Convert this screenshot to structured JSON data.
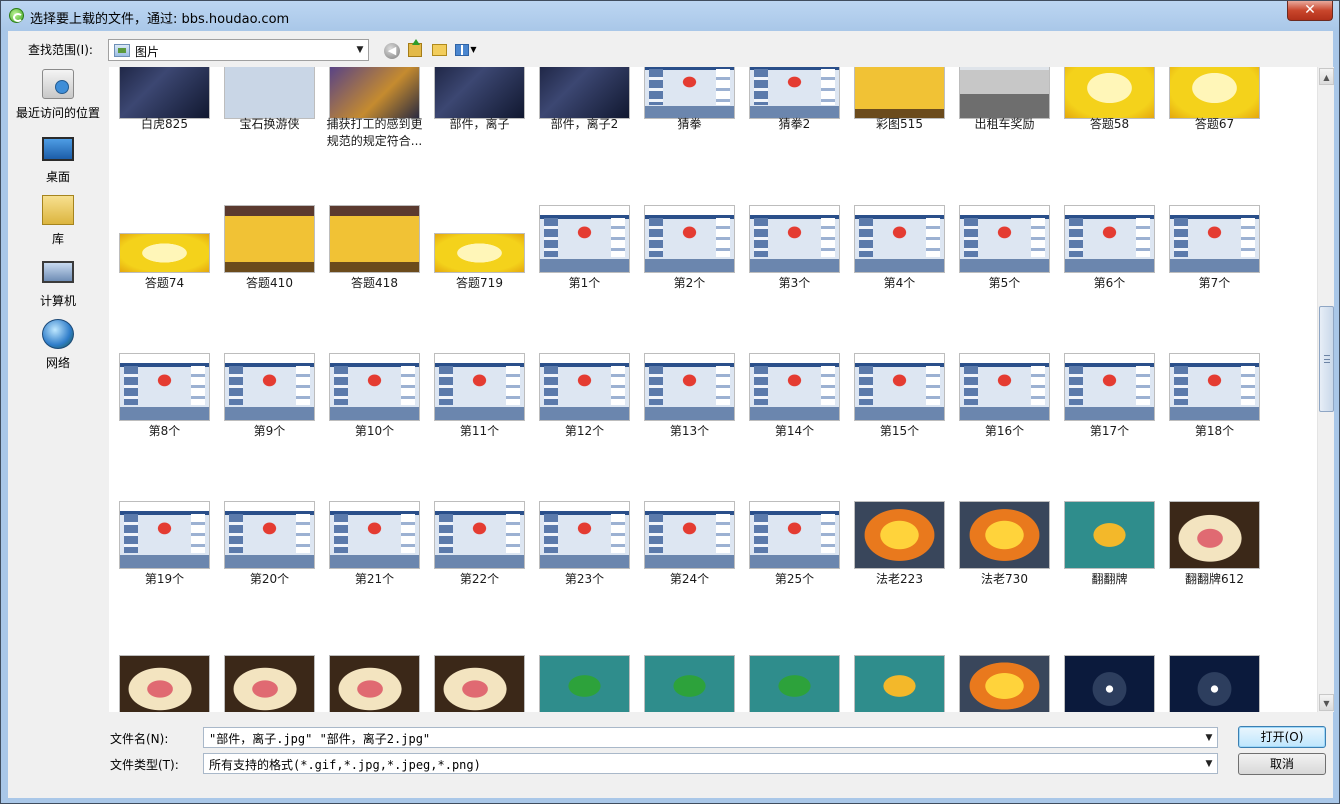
{
  "window": {
    "title": "选择要上载的文件，通过: bbs.houdao.com",
    "close_label": "✕"
  },
  "toolbar": {
    "lookin_label": "查找范围(I):",
    "lookin_value": "图片",
    "icons": [
      "back-icon",
      "up-folder-icon",
      "new-folder-icon",
      "view-menu-icon"
    ]
  },
  "places": [
    {
      "label": "最近访问的位置",
      "icon": "recent-places-icon"
    },
    {
      "label": "桌面",
      "icon": "desktop-icon"
    },
    {
      "label": "库",
      "icon": "libraries-icon"
    },
    {
      "label": "计算机",
      "icon": "computer-icon"
    },
    {
      "label": "网络",
      "icon": "network-icon"
    }
  ],
  "files": [
    {
      "name": "白虎825",
      "thumb": "t-dark"
    },
    {
      "name": "宝石换游侠",
      "thumb": "t-dialog"
    },
    {
      "name": "捕获打工的感到更规范的规定符合...",
      "thumb": "t-purple"
    },
    {
      "name": "部件，离子",
      "thumb": "t-dark"
    },
    {
      "name": "部件，离子2",
      "thumb": "t-dark"
    },
    {
      "name": "猜拳",
      "thumb": "t-game"
    },
    {
      "name": "猜拳2",
      "thumb": "t-game"
    },
    {
      "name": "彩图515",
      "thumb": "t-cbg"
    },
    {
      "name": "出租车奖励",
      "thumb": "t-city"
    },
    {
      "name": "答题58",
      "thumb": "t-yellow"
    },
    {
      "name": "答题67",
      "thumb": "t-yellow"
    },
    {
      "name": "答题74",
      "thumb": "t-yellow"
    },
    {
      "name": "答题410",
      "thumb": "t-cbg"
    },
    {
      "name": "答题418",
      "thumb": "t-cbg"
    },
    {
      "name": "答题719",
      "thumb": "t-yellow"
    },
    {
      "name": "第1个",
      "thumb": "t-game"
    },
    {
      "name": "第2个",
      "thumb": "t-game"
    },
    {
      "name": "第3个",
      "thumb": "t-game"
    },
    {
      "name": "第4个",
      "thumb": "t-game"
    },
    {
      "name": "第5个",
      "thumb": "t-game"
    },
    {
      "name": "第6个",
      "thumb": "t-game"
    },
    {
      "name": "第7个",
      "thumb": "t-game"
    },
    {
      "name": "第8个",
      "thumb": "t-game"
    },
    {
      "name": "第9个",
      "thumb": "t-game"
    },
    {
      "name": "第10个",
      "thumb": "t-game"
    },
    {
      "name": "第11个",
      "thumb": "t-game"
    },
    {
      "name": "第12个",
      "thumb": "t-game"
    },
    {
      "name": "第13个",
      "thumb": "t-game"
    },
    {
      "name": "第14个",
      "thumb": "t-game"
    },
    {
      "name": "第15个",
      "thumb": "t-game"
    },
    {
      "name": "第16个",
      "thumb": "t-game"
    },
    {
      "name": "第17个",
      "thumb": "t-game"
    },
    {
      "name": "第18个",
      "thumb": "t-game"
    },
    {
      "name": "第19个",
      "thumb": "t-game"
    },
    {
      "name": "第20个",
      "thumb": "t-game"
    },
    {
      "name": "第21个",
      "thumb": "t-game"
    },
    {
      "name": "第22个",
      "thumb": "t-game"
    },
    {
      "name": "第23个",
      "thumb": "t-game"
    },
    {
      "name": "第24个",
      "thumb": "t-game"
    },
    {
      "name": "第25个",
      "thumb": "t-game"
    },
    {
      "name": "法老223",
      "thumb": "t-fire"
    },
    {
      "name": "法老730",
      "thumb": "t-fire"
    },
    {
      "name": "翻翻牌",
      "thumb": "t-teal-y"
    },
    {
      "name": "翻翻牌612",
      "thumb": "t-monster"
    },
    {
      "name": "",
      "thumb": "t-monster"
    },
    {
      "name": "",
      "thumb": "t-monster"
    },
    {
      "name": "",
      "thumb": "t-monster"
    },
    {
      "name": "",
      "thumb": "t-monster"
    },
    {
      "name": "",
      "thumb": "t-teal"
    },
    {
      "name": "",
      "thumb": "t-teal"
    },
    {
      "name": "",
      "thumb": "t-teal"
    },
    {
      "name": "",
      "thumb": "t-teal-y"
    },
    {
      "name": "",
      "thumb": "t-fire"
    },
    {
      "name": "",
      "thumb": "t-spin"
    },
    {
      "name": "",
      "thumb": "t-spin"
    }
  ],
  "bottom": {
    "filename_label": "文件名(N):",
    "filename_value": "\"部件，离子.jpg\" \"部件，离子2.jpg\"",
    "filetype_label": "文件类型(T):",
    "filetype_value": "所有支持的格式(*.gif,*.jpg,*.jpeg,*.png)",
    "open_label": "打开(O)",
    "cancel_label": "取消"
  },
  "scrollbar": {
    "position_fraction": 0.44
  }
}
